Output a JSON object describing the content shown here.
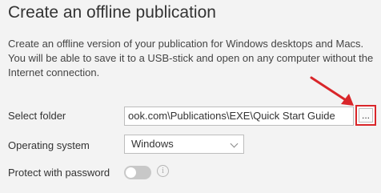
{
  "header": {
    "title": "Create an offline publication",
    "description": "Create an offline version of your publication for Windows desktops and Macs. You will be able to save it to a USB-stick and open on any computer without the Internet connection."
  },
  "form": {
    "folder": {
      "label": "Select folder",
      "value": "ook.com\\Publications\\EXE\\Quick Start Guide",
      "browse_label": "..."
    },
    "os": {
      "label": "Operating system",
      "selected": "Windows"
    },
    "password": {
      "label": "Protect with password",
      "enabled": false,
      "info_glyph": "i"
    }
  },
  "annotation": {
    "arrow_color": "#d9262a",
    "highlight_color": "#d9262a"
  },
  "icons": {
    "browse": "ellipsis-icon",
    "dropdown": "chevron-down-icon",
    "info": "info-icon"
  }
}
